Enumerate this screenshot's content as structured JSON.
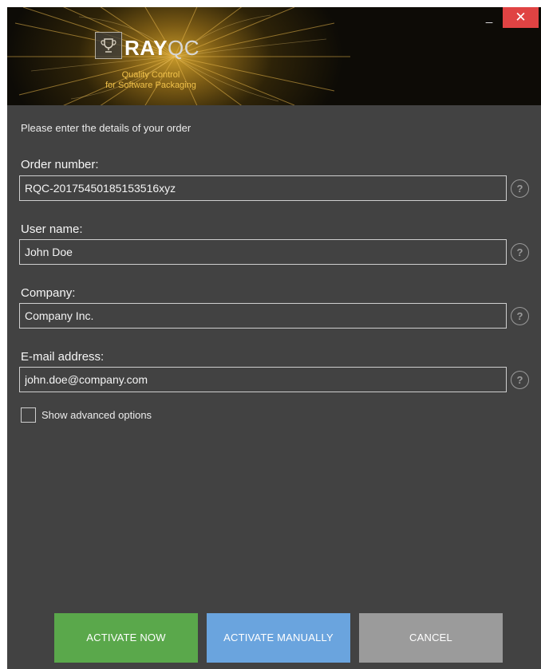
{
  "window": {
    "brand_primary": "RAY",
    "brand_secondary": "QC",
    "tagline_line1": "Quality Control",
    "tagline_line2": "for Software Packaging",
    "minimize_label": "_",
    "close_label": "✕"
  },
  "form": {
    "intro": "Please enter the details of your order",
    "fields": [
      {
        "label": "Order number:",
        "value": "RQC-20175450185153516xyz"
      },
      {
        "label": "User name:",
        "value": "John Doe"
      },
      {
        "label": "Company:",
        "value": "Company Inc."
      },
      {
        "label": "E-mail address:",
        "value": "john.doe@company.com"
      }
    ],
    "help_label": "?",
    "advanced_label": "Show advanced options"
  },
  "actions": {
    "activate_now": "ACTIVATE NOW",
    "activate_manually": "ACTIVATE MANUALLY",
    "cancel": "CANCEL"
  },
  "colors": {
    "background": "#424242",
    "activate": "#5aa84b",
    "manual": "#6aa4de",
    "cancel": "#9b9b9b",
    "close": "#e04343",
    "tagline": "#f1c24a"
  }
}
